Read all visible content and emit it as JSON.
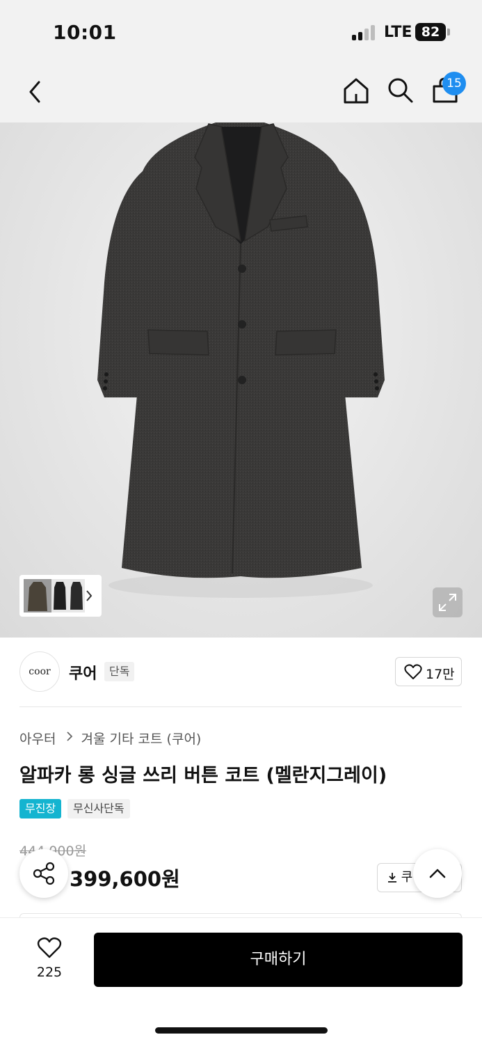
{
  "status_bar": {
    "time": "10:01",
    "network": "LTE",
    "battery": "82"
  },
  "header": {
    "cart_count": "15"
  },
  "gallery": {
    "thumb_count": 3
  },
  "brand": {
    "logo_text": "coor",
    "name": "쿠어",
    "badge": "단독",
    "like_count": "17만"
  },
  "product": {
    "breadcrumb": [
      "아우터",
      "겨울 기타 코트 (쿠어)"
    ],
    "title": "알파카 롱 싱글 쓰리 버튼 코트 (멜란지그레이)",
    "tags": [
      "무진장",
      "무신사단독"
    ],
    "original_price": "444,000원",
    "final_price": "399,600원",
    "coupon_label": "쿠"
  },
  "bottom_bar": {
    "wish_count": "225",
    "buy_label": "구매하기"
  },
  "colors": {
    "accent_blue": "#1f8ef0",
    "tag_teal": "#14b4d0",
    "buy_button": "#000000"
  },
  "icons": [
    "back-icon",
    "home-icon",
    "search-icon",
    "cart-icon",
    "expand-icon",
    "heart-icon",
    "share-icon",
    "download-icon",
    "chevron-up-icon"
  ]
}
